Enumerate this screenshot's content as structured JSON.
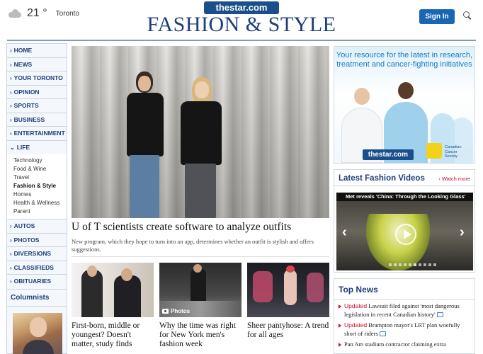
{
  "weather": {
    "temp": "21",
    "unit": "°",
    "city": "Toronto"
  },
  "header": {
    "logo": "thestar.com",
    "section_title": "FASHION & STYLE",
    "signin_label": "Sign In"
  },
  "nav": {
    "items_top": [
      "HOME",
      "NEWS",
      "YOUR TORONTO",
      "OPINION",
      "SPORTS",
      "BUSINESS",
      "ENTERTAINMENT",
      "LIFE"
    ],
    "life_sub": [
      "Technology",
      "Food & Wine",
      "Travel",
      "Fashion & Style",
      "Homes",
      "Health & Wellness",
      "Parent"
    ],
    "life_active": "Fashion & Style",
    "items_bottom": [
      "AUTOS",
      "PHOTOS",
      "DIVERSIONS",
      "CLASSIFIEDS",
      "OBITUARIES"
    ]
  },
  "columnists": {
    "heading": "Columnists"
  },
  "hero": {
    "headline": "U of T scientists create software to analyze outfits",
    "dek": "New program, which they hope to turn into an app, determines whether an outfit is stylish and offers suggestions."
  },
  "stories": [
    {
      "title": "First-born, middle or youngest? Doesn't matter, study finds"
    },
    {
      "title": "Why the time was right for New York men's fashion week",
      "badge": "Photos"
    },
    {
      "title": "Sheer pantyhose: A trend for all ages"
    }
  ],
  "ad": {
    "copy": "Your resource for the latest in research, treatment and cancer-fighting initiatives",
    "logo": "thestar.com",
    "sponsor": "Canadian Cancer Society"
  },
  "videos": {
    "heading": "Latest Fashion Videos",
    "more_label": "Watch more",
    "current_title": "Met reveals 'China: Through the Looking Glass'",
    "slide_count": 10,
    "active_slide": 5
  },
  "top_news": {
    "heading": "Top News",
    "items": [
      {
        "tag": "Updated",
        "text": "Lawsuit filed against 'most dangerous legislation in recent Canadian history'"
      },
      {
        "tag": "Updated",
        "text": "Brampton mayor's LRT plan woefully short of riders"
      },
      {
        "tag": "",
        "text": "Pan Am stadium contractor claiming extra"
      }
    ]
  },
  "colors": {
    "brand": "#1c3f7a",
    "accent": "#c8102e",
    "button": "#1a66b3"
  }
}
